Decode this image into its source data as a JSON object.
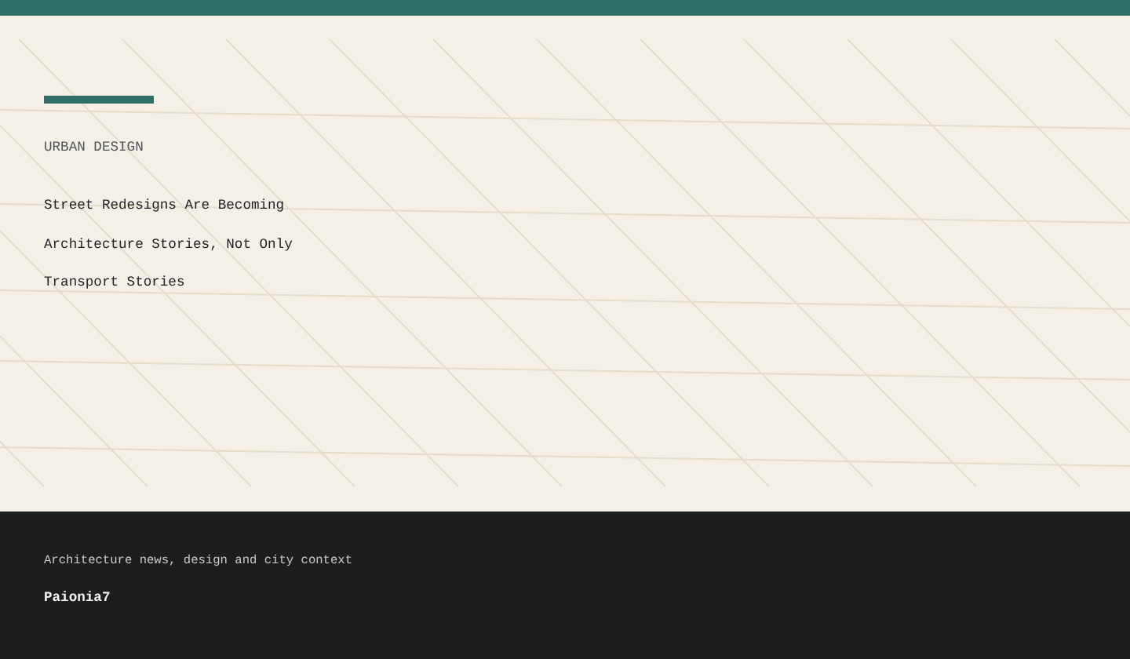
{
  "hero": {
    "kicker": "URBAN DESIGN",
    "headline_lines": [
      "Street Redesigns Are Becoming",
      "Architecture Stories, Not Only",
      "Transport Stories"
    ]
  },
  "footer": {
    "tagline": "Architecture news, design and city context",
    "brand": "Paionia7"
  }
}
